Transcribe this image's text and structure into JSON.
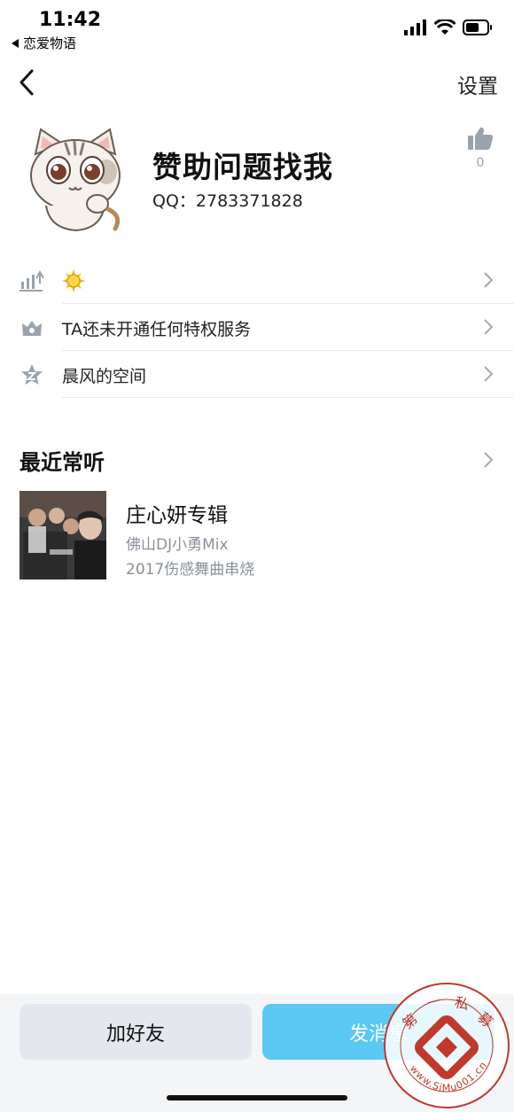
{
  "status_bar": {
    "time": "11:42",
    "back_app": "恋爱物语"
  },
  "nav": {
    "settings_label": "设置"
  },
  "profile": {
    "name": "赞助问题找我",
    "qq": "QQ：2783371828",
    "likes": "0"
  },
  "info_rows": [
    {
      "label": "",
      "icon": "level-icon"
    },
    {
      "label": "TA还未开通任何特权服务",
      "icon": "crown-icon"
    },
    {
      "label": "晨风的空间",
      "icon": "star-z-icon"
    }
  ],
  "recent": {
    "title": "最近常听",
    "album": {
      "title": "庄心妍专辑",
      "artist": "佛山DJ小勇Mix",
      "desc": "2017伤感舞曲串烧"
    }
  },
  "actions": {
    "add_friend": "加好友",
    "send_message": "发消息"
  },
  "watermark": {
    "chars": [
      "第",
      "一",
      "私",
      "募"
    ],
    "url": "www.SiMu001.cn"
  },
  "colors": {
    "primary_button": "#5ac8f5",
    "secondary_button": "#e5e7ee",
    "icon_gray": "#9aa3ad",
    "watermark_red": "#c0392b"
  }
}
